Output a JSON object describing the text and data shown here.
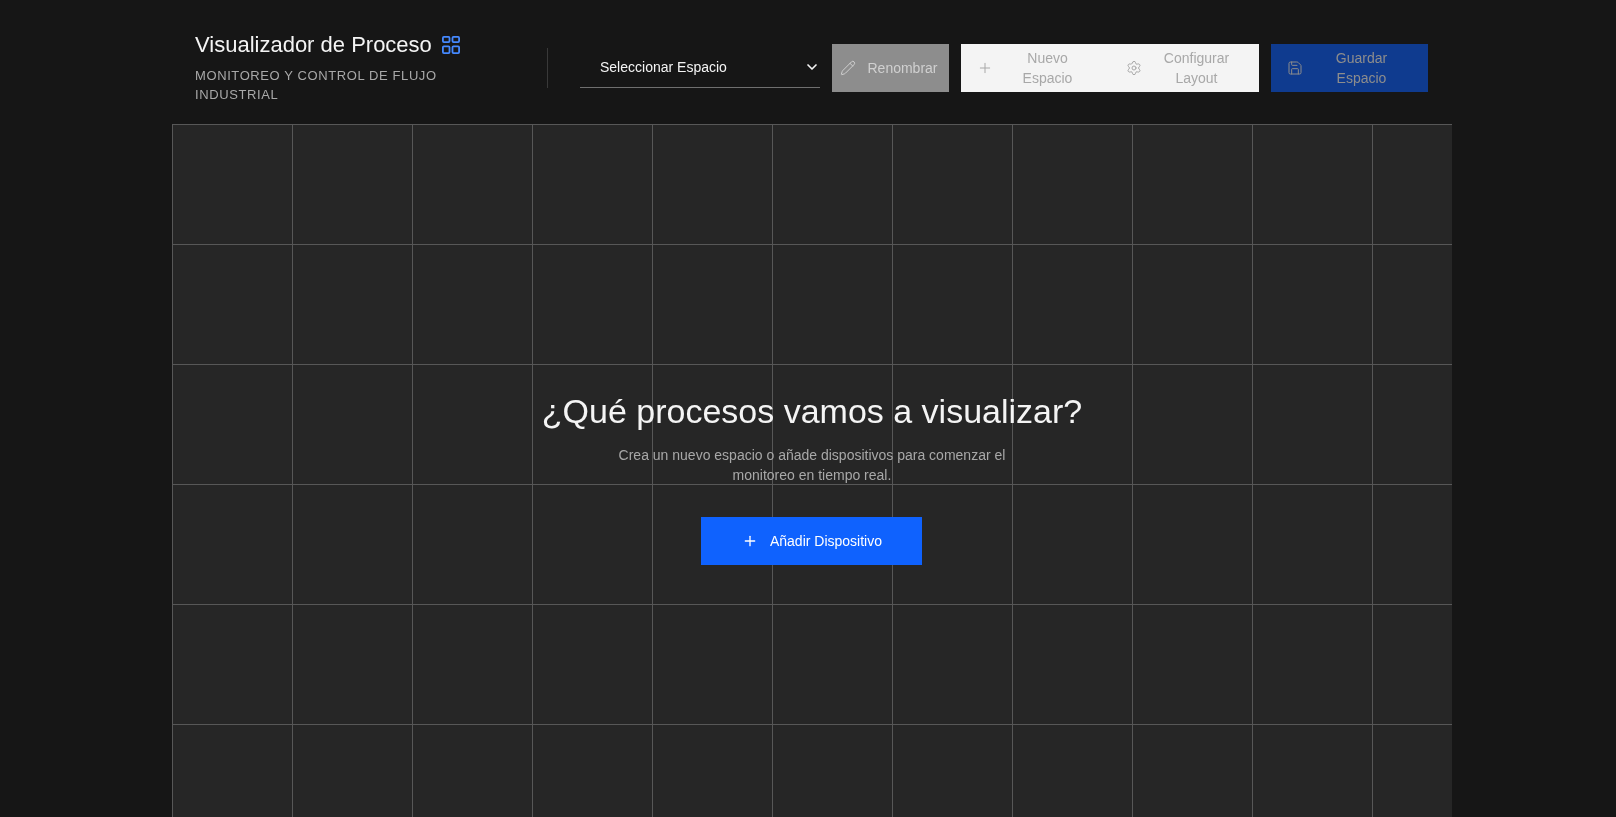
{
  "header": {
    "title": "Visualizador de Proceso",
    "subtitle": "MONITOREO Y CONTROL DE FLUJO INDUSTRIAL"
  },
  "toolbar": {
    "space_select": {
      "value": "Seleccionar Espacio"
    },
    "buttons": [
      {
        "label": "Renombrar",
        "kind": "tertiary",
        "disabled": true
      },
      {
        "label": "Nuevo Espacio",
        "kind": "secondary",
        "disabled": false
      },
      {
        "label": "Configurar Layout",
        "kind": "secondary",
        "disabled": false
      },
      {
        "label": "Guardar Espacio",
        "kind": "primary",
        "disabled": true
      }
    ]
  },
  "canvas": {
    "empty_state": {
      "heading": "¿Qué procesos vamos a visualizar?",
      "description": "Crea un nuevo espacio o añade dispositivos para comenzar el monitoreo en tiempo real.",
      "button": "Añadir Dispositivo"
    }
  }
}
